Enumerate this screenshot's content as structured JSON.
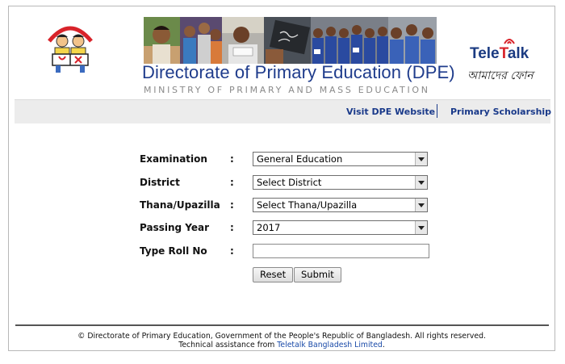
{
  "header": {
    "logo_icon": "dpe-children-reading-logo",
    "photos": [
      "boy-smiling-photo",
      "children-group-photo",
      "child-reading-photo",
      "slate-writing-photo",
      "students-crowd-photo",
      "students-blue-uniform-photo"
    ],
    "title": "Directorate of Primary Education (DPE)",
    "subtitle": "Ministry of Primary and Mass Education",
    "brand": {
      "name_part1": "Tele",
      "name_part2": "T",
      "name_part3": "alk",
      "tagline": "আমাদের ফোন",
      "colors": {
        "blue": "#1b3b82",
        "red": "#d8232a"
      }
    }
  },
  "nav": {
    "visit_label": "Visit DPE Website",
    "scholarship_label": "Primary Scholarship"
  },
  "form": {
    "examination": {
      "label": "Examination",
      "colon": ":",
      "value": "General Education"
    },
    "district": {
      "label": "District",
      "colon": ":",
      "value": "Select District"
    },
    "thana": {
      "label": "Thana/Upazilla",
      "colon": ":",
      "value": "Select Thana/Upazilla"
    },
    "passing_year": {
      "label": "Passing Year",
      "colon": ":",
      "value": "2017"
    },
    "roll": {
      "label": "Type Roll No",
      "colon": ":",
      "value": ""
    },
    "reset_label": "Reset",
    "submit_label": "Submit"
  },
  "footer": {
    "copyright": "© Directorate of Primary Education, Government of the People's Republic of Bangladesh. All rights reserved.",
    "tech_prefix": "Technical assistance from ",
    "tech_link": "Teletalk Bangladesh Limited",
    "tech_suffix": "."
  },
  "colors": {
    "accent": "#1a3a8a",
    "nav_bg": "#ececec",
    "title": "#1f3c8c"
  }
}
